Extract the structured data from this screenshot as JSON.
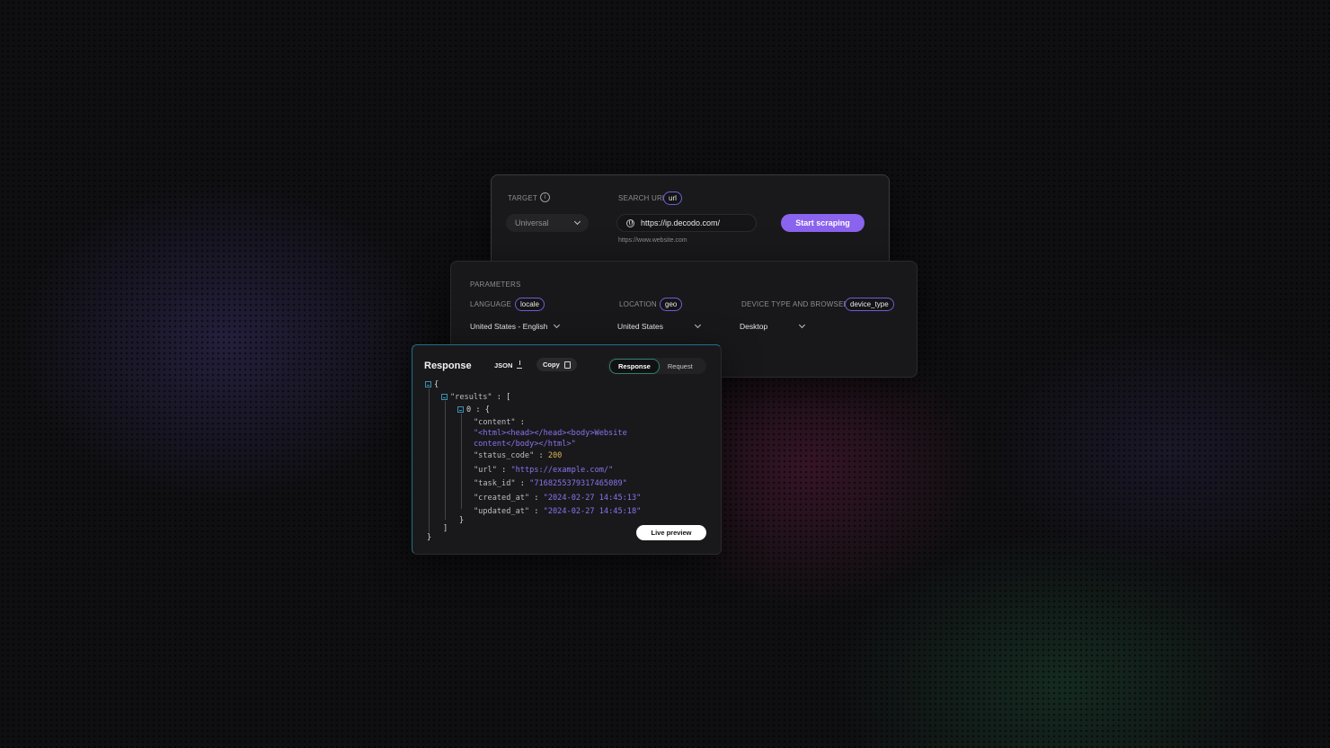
{
  "target": {
    "label": "TARGET",
    "selected": "Universal"
  },
  "search_url": {
    "label": "SEARCH URL",
    "tag": "url",
    "value": "https://ip.decodo.com/",
    "hint": "https://www.website.com",
    "start_button": "Start scraping"
  },
  "parameters": {
    "title": "PARAMETERS",
    "language": {
      "label": "LANGUAGE",
      "tag": "locale",
      "value": "United States - English"
    },
    "location": {
      "label": "LOCATION",
      "tag": "geo",
      "value": "United States"
    },
    "device": {
      "label": "DEVICE TYPE AND BROWSER",
      "tag": "device_type",
      "value": "Desktop"
    }
  },
  "response": {
    "title": "Response",
    "json_label": "JSON",
    "copy_label": "Copy",
    "tabs": [
      {
        "label": "Response",
        "active": true
      },
      {
        "label": "Request",
        "active": false
      }
    ],
    "live_preview": "Live preview",
    "json": {
      "open_brace": "{",
      "results_key": "\"results\"",
      "results_open": "[",
      "index": "0",
      "index_open": "{",
      "content_key": "\"content\"",
      "content_value_1": "\"<html><head></head><body>Website",
      "content_value_2": "content</body></html>\"",
      "status_code_key": "\"status_code\"",
      "status_code_value": "200",
      "url_key": "\"url\"",
      "url_value": "\"https://example.com/\"",
      "task_id_key": "\"task_id\"",
      "task_id_value": "\"7168255379317465089\"",
      "created_at_key": "\"created_at\"",
      "created_at_value": "\"2024-02-27 14:45:13\"",
      "updated_at_key": "\"updated_at\"",
      "updated_at_value": "\"2024-02-27 14:45:18\"",
      "index_close": "}",
      "results_close": "]",
      "close_brace": "}",
      "colon": ":"
    }
  },
  "colors": {
    "accent": "#8a63ee",
    "string": "#8b72f0",
    "number": "#e0b357",
    "tree_box": "#3b8fb0"
  }
}
